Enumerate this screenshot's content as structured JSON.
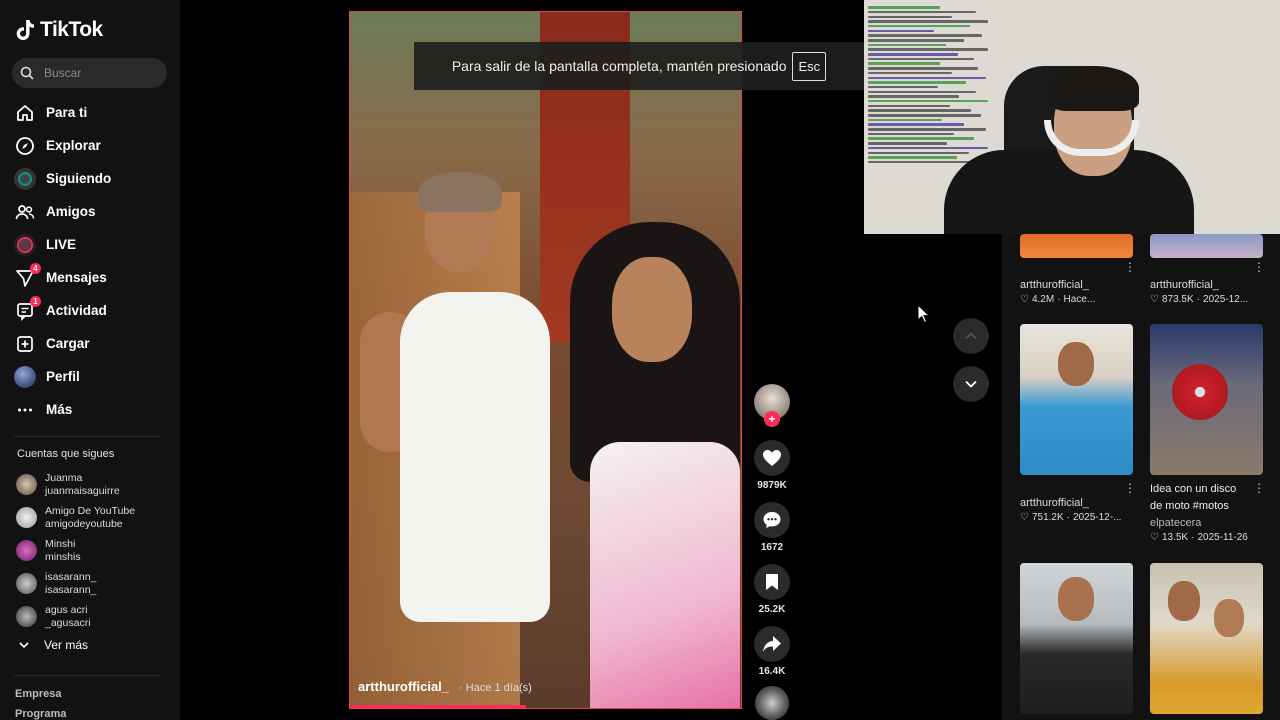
{
  "app": {
    "name": "TikTok",
    "accent": "#fe2c55"
  },
  "search": {
    "placeholder": "Buscar"
  },
  "nav": [
    {
      "label": "Para ti",
      "icon": "home-icon"
    },
    {
      "label": "Explorar",
      "icon": "compass-icon"
    },
    {
      "label": "Siguiendo",
      "icon": "following-avatar-icon"
    },
    {
      "label": "Amigos",
      "icon": "friends-icon"
    },
    {
      "label": "LIVE",
      "icon": "live-icon"
    },
    {
      "label": "Mensajes",
      "icon": "messages-icon",
      "badge": "4"
    },
    {
      "label": "Actividad",
      "icon": "activity-icon",
      "badge": "1"
    },
    {
      "label": "Cargar",
      "icon": "upload-icon"
    },
    {
      "label": "Perfil",
      "icon": "profile-avatar-icon"
    },
    {
      "label": "Más",
      "icon": "more-icon"
    }
  ],
  "following": {
    "title": "Cuentas que sigues",
    "items": [
      {
        "name": "Juanma",
        "handle": "juanmaisaguirre"
      },
      {
        "name": "Amigo De YouTube",
        "handle": "amigodeyoutube"
      },
      {
        "name": "Minshi",
        "handle": "minshis"
      },
      {
        "name": "isasarann_",
        "handle": "isasarann_"
      },
      {
        "name": "agus acri",
        "handle": "_agusacri"
      }
    ],
    "more": "Ver más"
  },
  "footer": [
    "Empresa",
    "Programa"
  ],
  "toast": {
    "text": "Para salir de la pantalla completa, mantén presionado",
    "key": "Esc"
  },
  "video": {
    "author": "artthurofficial_",
    "time": "Hace 1 día(s)",
    "progress": 0.45
  },
  "actions": {
    "likes": "9879K",
    "comments": "1672",
    "saves": "25.2K",
    "shares": "16.4K"
  },
  "related": [
    {
      "user": "artthurofficial_",
      "likes": "4.2M",
      "date": "Hace..."
    },
    {
      "user": "artthurofficial_",
      "likes": "873.5K",
      "date": "2025-12..."
    },
    {
      "user": "artthurofficial_",
      "likes": "751.2K",
      "date": "2025-12-..."
    },
    {
      "desc": "Idea con un disco de moto #motos",
      "user": "elpatecera",
      "likes": "13.5K",
      "date": "2025-11-26"
    }
  ]
}
